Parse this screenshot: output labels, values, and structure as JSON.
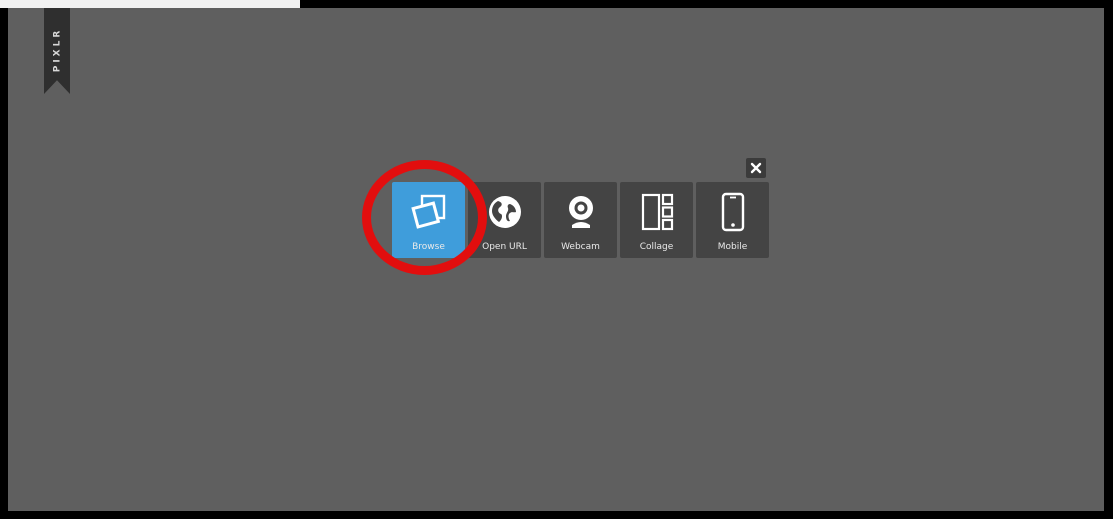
{
  "brand": {
    "ribbon_label": "PIXLR"
  },
  "dialog": {
    "close_label": "close",
    "options": [
      {
        "label": "Browse",
        "icon": "browse-photos-icon",
        "active": true
      },
      {
        "label": "Open URL",
        "icon": "globe-icon",
        "active": false
      },
      {
        "label": "Webcam",
        "icon": "webcam-icon",
        "active": false
      },
      {
        "label": "Collage",
        "icon": "collage-icon",
        "active": false
      },
      {
        "label": "Mobile",
        "icon": "mobile-icon",
        "active": false
      }
    ]
  },
  "colors": {
    "stage_background": "#5f5f5f",
    "tile_background": "#444444",
    "active_tile": "#3f9ddb",
    "highlight_ring": "#e20e0e"
  }
}
